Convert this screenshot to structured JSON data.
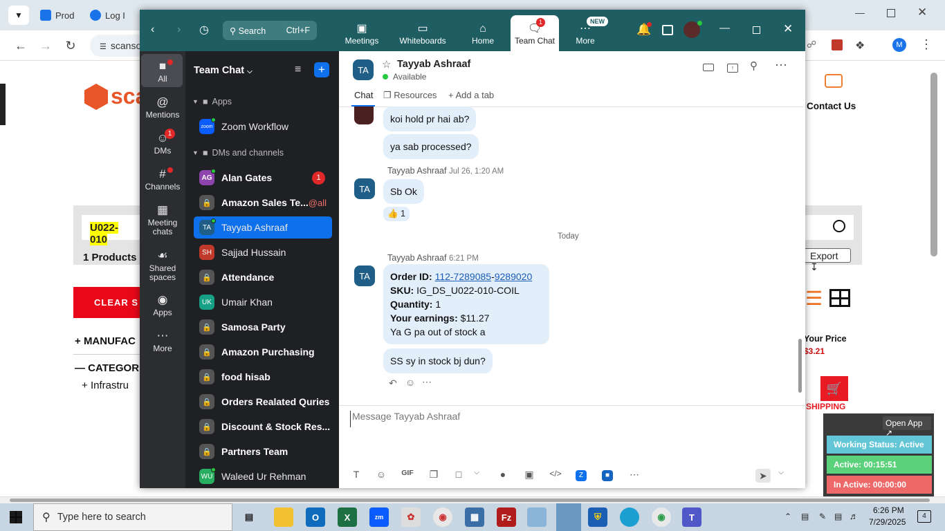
{
  "browser": {
    "tabs": [
      {
        "label": "Prod",
        "color": "#1a73e8"
      },
      {
        "label": "Log I",
        "color": "#1a73e8"
      }
    ],
    "address_fragment": "scanso",
    "profile_initial": "M"
  },
  "website": {
    "logo_text": "sca",
    "search_value": "U022-010",
    "products_count": "1 Products",
    "clear_button": "CLEAR S",
    "filter_manufacturer": "MANUFAC",
    "filter_category": "CATEGOR",
    "filter_infra": "Infrastru",
    "contact_us": "Contact Us",
    "export_button": "Export",
    "your_price_label": "Your Price",
    "your_price_value": "$3.21",
    "shipping_label": "SHIPPING"
  },
  "zoom": {
    "search_label": "Search",
    "search_shortcut": "Ctrl+F",
    "top_tabs": [
      {
        "label": "Meetings",
        "icon": "video-icon"
      },
      {
        "label": "Whiteboards",
        "icon": "whiteboard-icon"
      },
      {
        "label": "Home",
        "icon": "home-icon"
      },
      {
        "label": "Team Chat",
        "icon": "chat-icon",
        "badge": "1",
        "active": true
      },
      {
        "label": "More",
        "icon": "more-icon",
        "badge": "NEW"
      }
    ],
    "rail": [
      {
        "label": "All",
        "icon": "chat-bubble-icon"
      },
      {
        "label": "Mentions",
        "icon": "at-icon"
      },
      {
        "label": "DMs",
        "icon": "people-icon",
        "badge": "1"
      },
      {
        "label": "Channels",
        "icon": "hash-icon"
      },
      {
        "label": "Meeting chats",
        "icon": "calendar-icon"
      },
      {
        "label": "Shared spaces",
        "icon": "share-icon"
      },
      {
        "label": "Apps",
        "icon": "apps-icon"
      },
      {
        "label": "More",
        "icon": "ellipsis-icon"
      }
    ],
    "sidebar": {
      "title": "Team Chat",
      "apps_header": "Apps",
      "zoom_workflow": "Zoom Workflow",
      "dms_header": "DMs and channels",
      "items": [
        {
          "label": "Alan Gates",
          "initials": "AG",
          "color": "#8e44ad",
          "bold": true,
          "badge": "1",
          "online": true
        },
        {
          "label": "Amazon Sales Te...",
          "lock": true,
          "bold": true,
          "mention": "@all"
        },
        {
          "label": "Tayyab Ashraaf",
          "initials": "TA",
          "color": "#1f5f87",
          "selected": true,
          "online": true
        },
        {
          "label": "Sajjad Hussain",
          "initials": "SH",
          "color": "#c0392b"
        },
        {
          "label": "Attendance",
          "lock": true,
          "bold": true
        },
        {
          "label": "Umair Khan",
          "initials": "UK",
          "color": "#16a085"
        },
        {
          "label": "Samosa Party",
          "lock": true,
          "bold": true
        },
        {
          "label": "Amazon Purchasing",
          "lock": true,
          "bold": true
        },
        {
          "label": "food hisab",
          "lock": true,
          "bold": true
        },
        {
          "label": "Orders Realated Quries",
          "lock": true,
          "bold": true
        },
        {
          "label": "Discount & Stock Res...",
          "lock": true,
          "bold": true
        },
        {
          "label": "Partners Team",
          "lock": true,
          "bold": true
        },
        {
          "label": "Waleed Ur Rehman",
          "initials": "WU",
          "color": "#27ae60",
          "online": true
        }
      ]
    },
    "chat": {
      "contact_initials": "TA",
      "contact_name": "Tayyab Ashraaf",
      "status": "Available",
      "tabs": {
        "chat": "Chat",
        "resources": "Resources",
        "add": "Add a tab"
      },
      "msg_hold": "koi hold pr hai ab?",
      "msg_processed": "ya sab processed?",
      "sender1": "Tayyab Ashraaf",
      "time1": "Jul 26, 1:20 AM",
      "msg_ok": "Sb Ok",
      "reaction": "👍 1",
      "divider": "Today",
      "sender2": "Tayyab Ashraaf",
      "time2": "6:21 PM",
      "order_label": "Order ID:",
      "order_part1": "112-7289085",
      "order_sep": "-",
      "order_part2": "9289020",
      "sku_label": "SKU:",
      "sku_value": "IG_DS_U022-010-COIL",
      "qty_label": "Quantity:",
      "qty_value": "1",
      "earn_label": "Your earnings:",
      "earn_value": "$11.27",
      "msg_stock": "Ya G pa out of stock a",
      "msg_ss": "SS sy in stock bj dun?",
      "input_placeholder": "Message Tayyab Ashraaf",
      "gif_label": "GIF"
    }
  },
  "widget": {
    "open_app": "Open App ↗",
    "working_status": "Working Status: Active",
    "active_time": "Active: 00:15:51",
    "inactive_time": "In Active: 00:00:00"
  },
  "taskbar": {
    "search_placeholder": "Type here to search",
    "time": "6:26 PM",
    "date": "7/29/2025",
    "notif_count": "4"
  }
}
